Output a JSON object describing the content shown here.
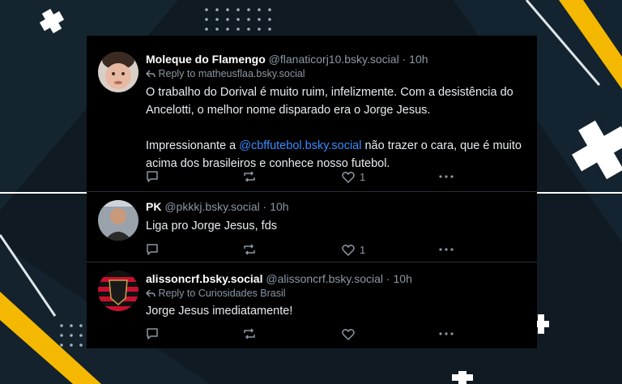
{
  "posts": [
    {
      "name": "Moleque do Flamengo",
      "handle": "@flanaticorj10.bsky.social",
      "sep": " · ",
      "time": "10h",
      "reply_to": "Reply to matheusflaa.bsky.social",
      "text_1": "O trabalho do Dorival é muito ruim, infelizmente. Com a desistência do Ancelotti, o melhor nome disparado era o Jorge Jesus.",
      "text_2_before": "Impressionante a ",
      "text_2_mention": "@cbffutebol.bsky.social",
      "text_2_after": " não trazer o cara, que é muito acima dos brasileiros e conhece nosso futebol.",
      "likes": "1"
    },
    {
      "name": "PK",
      "handle": "@pkkkj.bsky.social",
      "sep": " · ",
      "time": "10h",
      "text": "Liga pro Jorge Jesus, fds",
      "likes": "1"
    },
    {
      "name": "alissoncrf.bsky.social",
      "handle": "@alissoncrf.bsky.social",
      "sep": " · ",
      "time": "10h",
      "reply_to": "Reply to Curiosidades Brasil",
      "text": "Jorge Jesus imediatamente!",
      "likes": ""
    }
  ],
  "icons": {
    "reply": "reply-arrow-icon",
    "comment": "comment-bubble-icon",
    "repost": "repost-icon",
    "like": "heart-icon",
    "more": "more-dots-icon"
  },
  "colors": {
    "background": "#0f1a22",
    "card": "#000000",
    "accent_yellow": "#f5b800",
    "mention": "#3b8bff",
    "muted": "#8b98a5"
  }
}
